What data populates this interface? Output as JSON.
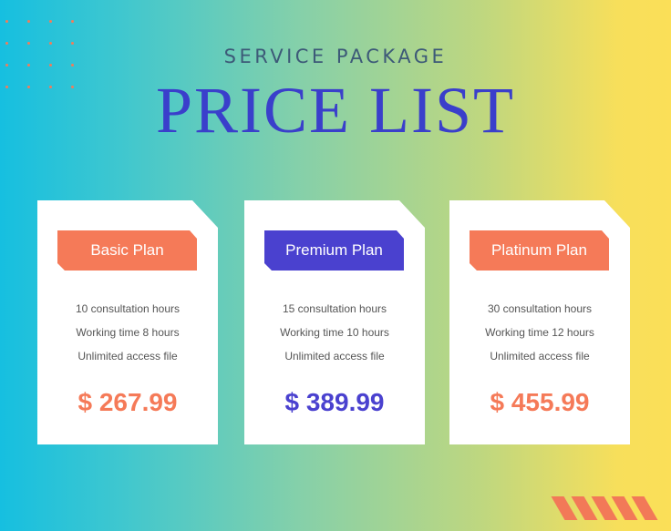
{
  "header": {
    "subtitle": "SERVICE PACKAGE",
    "title": "PRICE LIST"
  },
  "colors": {
    "accent_orange": "#f57a58",
    "accent_blue": "#4a41cf"
  },
  "plans": [
    {
      "name": "Basic Plan",
      "features": [
        "10 consultation hours",
        "Working time 8 hours",
        "Unlimited access file"
      ],
      "price": "$ 267.99"
    },
    {
      "name": "Premium Plan",
      "features": [
        "15 consultation hours",
        "Working time 10 hours",
        "Unlimited access file"
      ],
      "price": "$ 389.99"
    },
    {
      "name": "Platinum Plan",
      "features": [
        "30 consultation hours",
        "Working time 12 hours",
        "Unlimited access file"
      ],
      "price": "$ 455.99"
    }
  ]
}
